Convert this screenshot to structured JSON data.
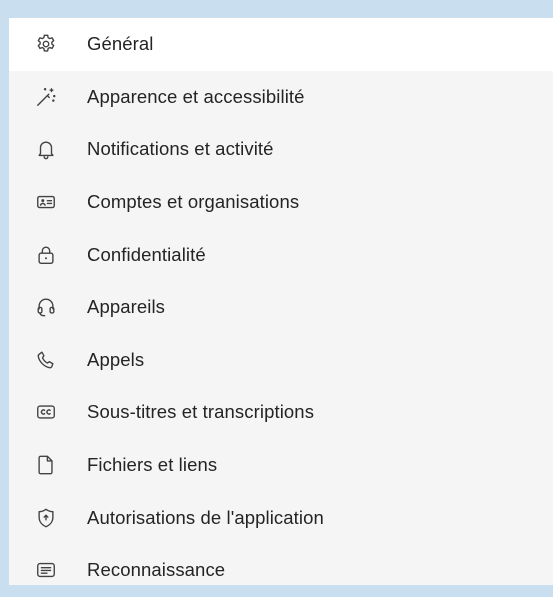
{
  "settings_menu": {
    "items": [
      {
        "label": "Général",
        "icon": "gear-icon",
        "selected": true
      },
      {
        "label": "Apparence et accessibilité",
        "icon": "magic-wand-icon"
      },
      {
        "label": "Notifications et activité",
        "icon": "bell-icon"
      },
      {
        "label": "Comptes et organisations",
        "icon": "contact-card-icon"
      },
      {
        "label": "Confidentialité",
        "icon": "lock-icon"
      },
      {
        "label": "Appareils",
        "icon": "headset-icon"
      },
      {
        "label": "Appels",
        "icon": "phone-icon"
      },
      {
        "label": "Sous-titres et transcriptions",
        "icon": "closed-caption-icon"
      },
      {
        "label": "Fichiers et liens",
        "icon": "file-icon"
      },
      {
        "label": "Autorisations de l'application",
        "icon": "shield-icon"
      },
      {
        "label": "Reconnaissance",
        "icon": "recognition-card-icon"
      }
    ]
  },
  "colors": {
    "backdrop": "#c9dff0",
    "panel": "#f5f5f5",
    "selected_row": "#ffffff",
    "text": "#242424",
    "icon_stroke": "#424242"
  }
}
